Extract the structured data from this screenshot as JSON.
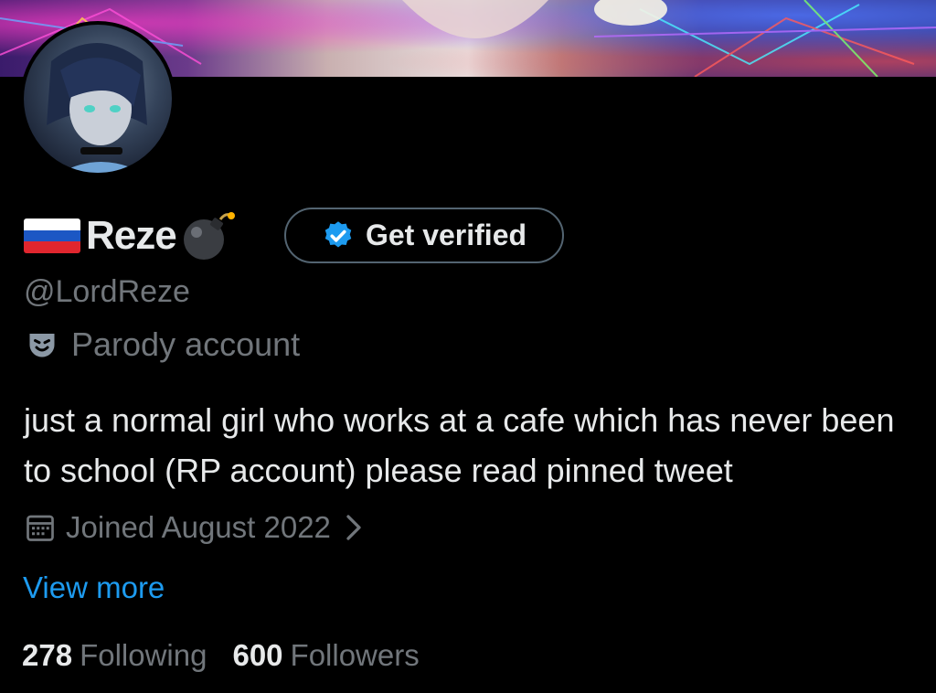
{
  "profile": {
    "display_name": "Reze",
    "handle": "@LordReze",
    "flag_icon": "russian-flag",
    "name_emoji_icon": "bomb-icon",
    "verify_button_label": "Get verified",
    "parody_label": "Parody account",
    "bio": "just a normal girl who works at a cafe which has never been to school (RP account) please read pinned tweet",
    "joined": "Joined August 2022",
    "view_more": "View more"
  },
  "stats": {
    "following_count": "278",
    "following_label": "Following",
    "followers_count": "600",
    "followers_label": "Followers"
  },
  "colors": {
    "background": "#000000",
    "text_primary": "#e7e9ea",
    "text_secondary": "#71767b",
    "link": "#1d9bf0",
    "verified_badge": "#1d9bf0"
  }
}
